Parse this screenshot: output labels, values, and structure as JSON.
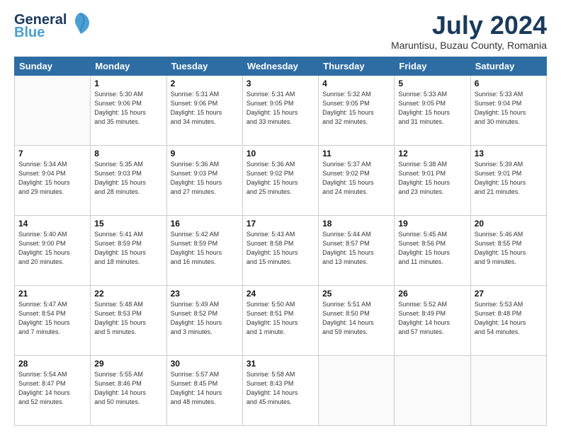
{
  "header": {
    "logo_line1": "General",
    "logo_line2": "Blue",
    "month_title": "July 2024",
    "location": "Maruntisu, Buzau County, Romania"
  },
  "weekdays": [
    "Sunday",
    "Monday",
    "Tuesday",
    "Wednesday",
    "Thursday",
    "Friday",
    "Saturday"
  ],
  "weeks": [
    [
      {
        "day": "",
        "info": ""
      },
      {
        "day": "1",
        "info": "Sunrise: 5:30 AM\nSunset: 9:06 PM\nDaylight: 15 hours\nand 35 minutes."
      },
      {
        "day": "2",
        "info": "Sunrise: 5:31 AM\nSunset: 9:06 PM\nDaylight: 15 hours\nand 34 minutes."
      },
      {
        "day": "3",
        "info": "Sunrise: 5:31 AM\nSunset: 9:05 PM\nDaylight: 15 hours\nand 33 minutes."
      },
      {
        "day": "4",
        "info": "Sunrise: 5:32 AM\nSunset: 9:05 PM\nDaylight: 15 hours\nand 32 minutes."
      },
      {
        "day": "5",
        "info": "Sunrise: 5:33 AM\nSunset: 9:05 PM\nDaylight: 15 hours\nand 31 minutes."
      },
      {
        "day": "6",
        "info": "Sunrise: 5:33 AM\nSunset: 9:04 PM\nDaylight: 15 hours\nand 30 minutes."
      }
    ],
    [
      {
        "day": "7",
        "info": "Sunrise: 5:34 AM\nSunset: 9:04 PM\nDaylight: 15 hours\nand 29 minutes."
      },
      {
        "day": "8",
        "info": "Sunrise: 5:35 AM\nSunset: 9:03 PM\nDaylight: 15 hours\nand 28 minutes."
      },
      {
        "day": "9",
        "info": "Sunrise: 5:36 AM\nSunset: 9:03 PM\nDaylight: 15 hours\nand 27 minutes."
      },
      {
        "day": "10",
        "info": "Sunrise: 5:36 AM\nSunset: 9:02 PM\nDaylight: 15 hours\nand 25 minutes."
      },
      {
        "day": "11",
        "info": "Sunrise: 5:37 AM\nSunset: 9:02 PM\nDaylight: 15 hours\nand 24 minutes."
      },
      {
        "day": "12",
        "info": "Sunrise: 5:38 AM\nSunset: 9:01 PM\nDaylight: 15 hours\nand 23 minutes."
      },
      {
        "day": "13",
        "info": "Sunrise: 5:39 AM\nSunset: 9:01 PM\nDaylight: 15 hours\nand 21 minutes."
      }
    ],
    [
      {
        "day": "14",
        "info": "Sunrise: 5:40 AM\nSunset: 9:00 PM\nDaylight: 15 hours\nand 20 minutes."
      },
      {
        "day": "15",
        "info": "Sunrise: 5:41 AM\nSunset: 8:59 PM\nDaylight: 15 hours\nand 18 minutes."
      },
      {
        "day": "16",
        "info": "Sunrise: 5:42 AM\nSunset: 8:59 PM\nDaylight: 15 hours\nand 16 minutes."
      },
      {
        "day": "17",
        "info": "Sunrise: 5:43 AM\nSunset: 8:58 PM\nDaylight: 15 hours\nand 15 minutes."
      },
      {
        "day": "18",
        "info": "Sunrise: 5:44 AM\nSunset: 8:57 PM\nDaylight: 15 hours\nand 13 minutes."
      },
      {
        "day": "19",
        "info": "Sunrise: 5:45 AM\nSunset: 8:56 PM\nDaylight: 15 hours\nand 11 minutes."
      },
      {
        "day": "20",
        "info": "Sunrise: 5:46 AM\nSunset: 8:55 PM\nDaylight: 15 hours\nand 9 minutes."
      }
    ],
    [
      {
        "day": "21",
        "info": "Sunrise: 5:47 AM\nSunset: 8:54 PM\nDaylight: 15 hours\nand 7 minutes."
      },
      {
        "day": "22",
        "info": "Sunrise: 5:48 AM\nSunset: 8:53 PM\nDaylight: 15 hours\nand 5 minutes."
      },
      {
        "day": "23",
        "info": "Sunrise: 5:49 AM\nSunset: 8:52 PM\nDaylight: 15 hours\nand 3 minutes."
      },
      {
        "day": "24",
        "info": "Sunrise: 5:50 AM\nSunset: 8:51 PM\nDaylight: 15 hours\nand 1 minute."
      },
      {
        "day": "25",
        "info": "Sunrise: 5:51 AM\nSunset: 8:50 PM\nDaylight: 14 hours\nand 59 minutes."
      },
      {
        "day": "26",
        "info": "Sunrise: 5:52 AM\nSunset: 8:49 PM\nDaylight: 14 hours\nand 57 minutes."
      },
      {
        "day": "27",
        "info": "Sunrise: 5:53 AM\nSunset: 8:48 PM\nDaylight: 14 hours\nand 54 minutes."
      }
    ],
    [
      {
        "day": "28",
        "info": "Sunrise: 5:54 AM\nSunset: 8:47 PM\nDaylight: 14 hours\nand 52 minutes."
      },
      {
        "day": "29",
        "info": "Sunrise: 5:55 AM\nSunset: 8:46 PM\nDaylight: 14 hours\nand 50 minutes."
      },
      {
        "day": "30",
        "info": "Sunrise: 5:57 AM\nSunset: 8:45 PM\nDaylight: 14 hours\nand 48 minutes."
      },
      {
        "day": "31",
        "info": "Sunrise: 5:58 AM\nSunset: 8:43 PM\nDaylight: 14 hours\nand 45 minutes."
      },
      {
        "day": "",
        "info": ""
      },
      {
        "day": "",
        "info": ""
      },
      {
        "day": "",
        "info": ""
      }
    ]
  ]
}
